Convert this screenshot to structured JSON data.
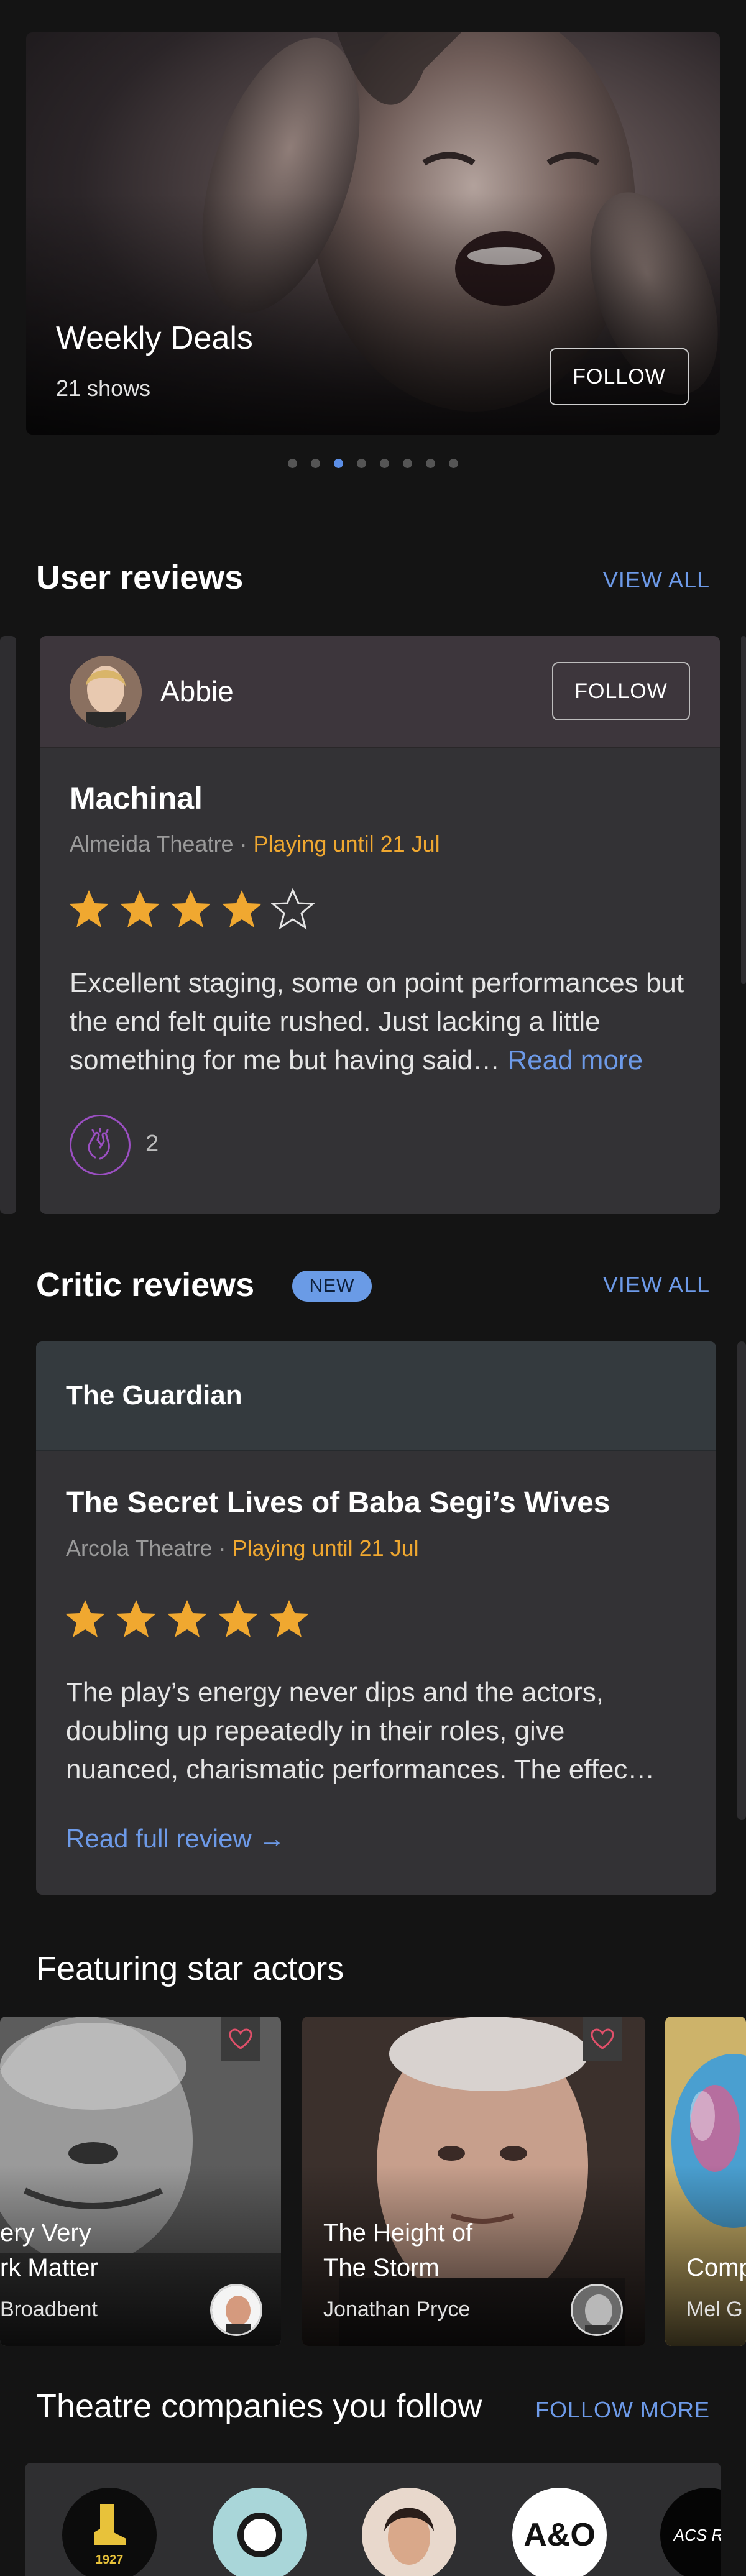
{
  "hero": {
    "title": "Weekly Deals",
    "subtitle": "21 shows",
    "follow_label": "FOLLOW",
    "carousel": {
      "count": 8,
      "active_index": 2
    }
  },
  "user_reviews": {
    "title": "User reviews",
    "view_all": "VIEW ALL",
    "card": {
      "user": "Abbie",
      "follow_label": "FOLLOW",
      "show": "Machinal",
      "venue": "Almeida Theatre",
      "separator": " · ",
      "status": "Playing until 21 Jul",
      "rating": 4,
      "max_rating": 5,
      "text": "Excellent staging, some on point performances but the end felt quite rushed. Just lacking a little something for me but having said…",
      "read_more": "Read more",
      "claps": "2"
    }
  },
  "critic_reviews": {
    "title": "Critic reviews",
    "badge": "NEW",
    "view_all": "VIEW ALL",
    "card": {
      "publication": "The Guardian",
      "show": "The Secret Lives of Baba Segi’s Wives",
      "venue": "Arcola Theatre",
      "separator": " · ",
      "status": "Playing until 21 Jul",
      "rating": 5,
      "max_rating": 5,
      "text_lines": [
        "The play’s energy never dips and the actors,",
        "doubling up repeatedly in their roles, give",
        "nuanced, charismatic performances. The effec…"
      ],
      "read_full": "Read full review →"
    }
  },
  "actors": {
    "title": "Featuring star actors",
    "items": [
      {
        "title_lines": [
          "ery Very",
          "rk Matter"
        ],
        "name": "Broadbent"
      },
      {
        "title_lines": [
          "The Height of",
          "The Storm"
        ],
        "name": "Jonathan Pryce"
      },
      {
        "title_lines": [
          "Comp"
        ],
        "name": "Mel G"
      }
    ]
  },
  "companies": {
    "title": "Theatre companies you follow",
    "follow_more": "FOLLOW MORE",
    "logos": [
      {
        "text": "1927",
        "bg": "#0c0c0c",
        "fg": "#e8c23a"
      },
      {
        "text": "",
        "bg": "#a9d6d9",
        "fg": "#222222"
      },
      {
        "text": "",
        "bg": "#e8d8cc",
        "fg": "#222222"
      },
      {
        "text": "A&O",
        "bg": "#ffffff",
        "fg": "#111111"
      },
      {
        "text": "ACS Ran",
        "bg": "#050505",
        "fg": "#ffffff"
      }
    ]
  },
  "colors": {
    "accent": "#6d9ae8",
    "star": "#f0a830",
    "status": "#f0a830",
    "clap": "#9b4fc2",
    "heart": "#e0506a"
  }
}
